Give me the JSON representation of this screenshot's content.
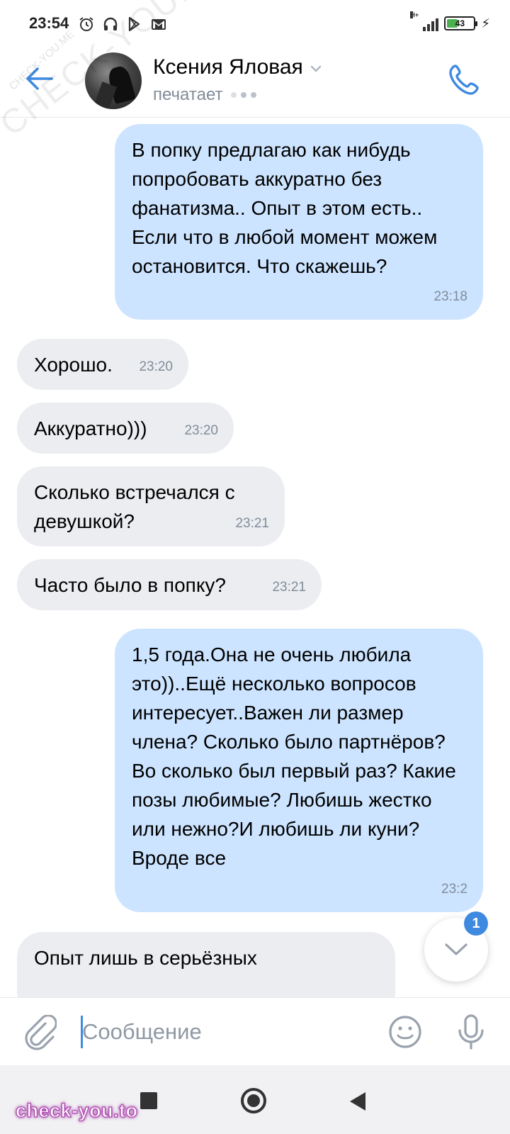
{
  "status_bar": {
    "time": "23:54",
    "network": "H+",
    "battery_level": "43",
    "battery_fraction": 0.43
  },
  "header": {
    "contact_name": "Ксения Яловая",
    "status": "печатает"
  },
  "messages": [
    {
      "id": "m1",
      "direction": "out",
      "text": "В попку предлагаю как нибудь попробовать аккуратно без фанатизма.. Опыт в этом есть.. Если что в любой  момент можем остановится. Что скажешь?",
      "time": "23:18"
    },
    {
      "id": "m2",
      "direction": "in",
      "text": "Хорошо.",
      "time": "23:20"
    },
    {
      "id": "m3",
      "direction": "in",
      "text": "Аккуратно)))",
      "time": "23:20"
    },
    {
      "id": "m4",
      "direction": "in",
      "text": "Сколько встречался с девушкой?",
      "time": "23:21"
    },
    {
      "id": "m5",
      "direction": "in",
      "text": "Часто было в попку?",
      "time": "23:21"
    },
    {
      "id": "m6",
      "direction": "out",
      "text": "1,5 года.Она не очень любила это))..Ещё несколько вопросов интересует..Важен ли размер члена? Сколько было партнёров? Во сколько был первый раз? Какие позы любимые? Любишь жестко или нежно?И любишь ли куни? Вроде все",
      "time": "23:2"
    },
    {
      "id": "m7",
      "direction": "in",
      "text": "Опыт лишь в серьёзных",
      "time": ""
    }
  ],
  "scroll_down": {
    "unread_count": "1"
  },
  "composer": {
    "placeholder": "Сообщение"
  },
  "watermarks": {
    "diagonal": "CHECK-YOU.ME",
    "diagonal_small": "CHECK-YOU.ME",
    "corner": "check-you.to"
  },
  "colors": {
    "accent": "#3f8ae0",
    "outgoing_bubble": "#cce4ff",
    "incoming_bubble": "#ebedf0",
    "secondary_text": "#818c99"
  }
}
